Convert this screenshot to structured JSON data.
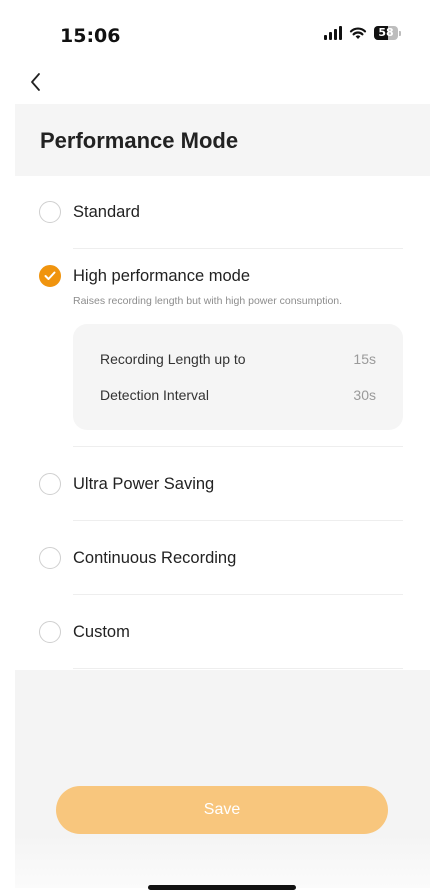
{
  "status_bar": {
    "time": "15:06",
    "battery_level": "58",
    "icons": [
      "signal-icon",
      "wifi-icon",
      "battery-icon"
    ]
  },
  "nav": {
    "back_icon": "chevron-left-icon"
  },
  "page": {
    "title": "Performance Mode"
  },
  "options": [
    {
      "label": "Standard",
      "checked": false
    },
    {
      "label": "High performance mode",
      "checked": true,
      "description": "Raises recording length but with high power consumption.",
      "details": [
        {
          "label": "Recording Length up to",
          "value": "15s"
        },
        {
          "label": "Detection Interval",
          "value": "30s"
        }
      ]
    },
    {
      "label": "Ultra Power Saving",
      "checked": false
    },
    {
      "label": "Continuous Recording",
      "checked": false
    },
    {
      "label": "Custom",
      "checked": false
    }
  ],
  "footer": {
    "save_label": "Save"
  },
  "colors": {
    "accent": "#f0940e",
    "save_button": "#f8c67d",
    "background_gray": "#f5f5f5"
  }
}
